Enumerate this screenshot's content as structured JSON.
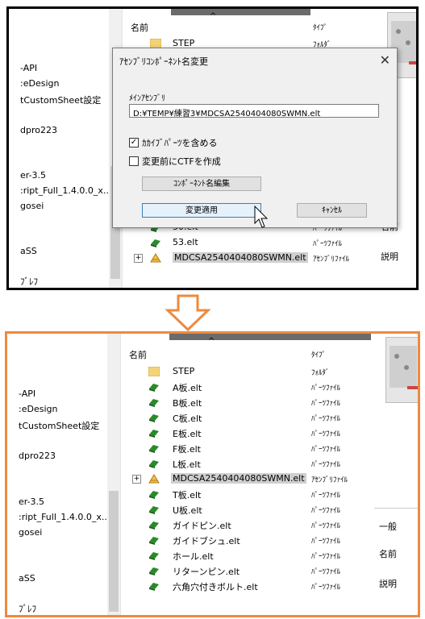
{
  "left_pane": {
    "top": [
      "-API",
      ":eDesign",
      "tCustomSheet設定",
      "dpro223"
    ],
    "bottom": [
      "er-3.5",
      ":ript_Full_1.4.0.0_x...",
      "gosei",
      "aSS",
      "ﾌﾞﾚﾌ"
    ]
  },
  "file_list": {
    "col_name": "名前",
    "col_type": "ﾀｲﾌﾟ",
    "sort_indicator": "^",
    "before_rows": [
      {
        "name": "STEP",
        "type": "ﾌｫﾙﾀﾞ",
        "icon": "folder-icon"
      },
      {
        "name": "50.elt",
        "type": "ﾊﾟｰﾂﾌｧｲﾙ",
        "icon": "part-icon"
      },
      {
        "name": "53.elt",
        "type": "ﾊﾟｰﾂﾌｧｲﾙ",
        "icon": "part-icon"
      },
      {
        "name": "MDCSA2540404080SWMN.elt",
        "type": "ｱｾﾝﾌﾞﾘﾌｧｲﾙ",
        "icon": "assembly-icon"
      }
    ],
    "after_rows": [
      {
        "name": "STEP",
        "type": "ﾌｫﾙﾀﾞ",
        "icon": "folder-icon"
      },
      {
        "name": "A板.elt",
        "type": "ﾊﾟｰﾂﾌｧｲﾙ",
        "icon": "part-icon"
      },
      {
        "name": "B板.elt",
        "type": "ﾊﾟｰﾂﾌｧｲﾙ",
        "icon": "part-icon"
      },
      {
        "name": "C板.elt",
        "type": "ﾊﾟｰﾂﾌｧｲﾙ",
        "icon": "part-icon"
      },
      {
        "name": "E板.elt",
        "type": "ﾊﾟｰﾂﾌｧｲﾙ",
        "icon": "part-icon"
      },
      {
        "name": "F板.elt",
        "type": "ﾊﾟｰﾂﾌｧｲﾙ",
        "icon": "part-icon"
      },
      {
        "name": "L板.elt",
        "type": "ﾊﾟｰﾂﾌｧｲﾙ",
        "icon": "part-icon"
      },
      {
        "name": "MDCSA2540404080SWMN.elt",
        "type": "ｱｾﾝﾌﾞﾘﾌｧｲﾙ",
        "icon": "assembly-icon"
      },
      {
        "name": "T板.elt",
        "type": "ﾊﾟｰﾂﾌｧｲﾙ",
        "icon": "part-icon"
      },
      {
        "name": "U板.elt",
        "type": "ﾊﾟｰﾂﾌｧｲﾙ",
        "icon": "part-icon"
      },
      {
        "name": "ガイドピン.elt",
        "type": "ﾊﾟｰﾂﾌｧｲﾙ",
        "icon": "part-icon"
      },
      {
        "name": "ガイドブシュ.elt",
        "type": "ﾊﾟｰﾂﾌｧｲﾙ",
        "icon": "part-icon"
      },
      {
        "name": "ホール.elt",
        "type": "ﾊﾟｰﾂﾌｧｲﾙ",
        "icon": "part-icon"
      },
      {
        "name": "リターンピン.elt",
        "type": "ﾊﾟｰﾂﾌｧｲﾙ",
        "icon": "part-icon"
      },
      {
        "name": "六角穴付きボルト.elt",
        "type": "ﾊﾟｰﾂﾌｧｲﾙ",
        "icon": "part-icon"
      }
    ]
  },
  "right_pane": {
    "before": [
      "名前",
      "説明"
    ],
    "after": [
      "一般",
      "名前",
      "説明"
    ]
  },
  "dialog": {
    "title": "ｱｾﾝﾌﾞﾘｺﾝﾎﾟｰﾈﾝﾄ名変更",
    "close": "✕",
    "main_assembly_label": "ﾒｲﾝｱｾﾝﾌﾞﾘ",
    "main_assembly_path": "D:¥TEMP¥練習3¥MDCSA2540404080SWMN.elt",
    "include_external_parts_label": "ｶｶｲﾌﾞﾊﾟｰﾂを含める",
    "include_external_parts_checked": true,
    "create_ctf_label": "変更前にCTFを作成",
    "create_ctf_checked": false,
    "component_edit_button": "ｺﾝﾎﾟｰﾈﾝﾄ名編集",
    "apply_button": "変更適用",
    "cancel_button": "ｷｬﾝｾﾙ"
  },
  "colors": {
    "before_border": "#000000",
    "after_border": "#ed8a3f",
    "arrow": "#ed8a3f",
    "part_icon": "#2a8a2a",
    "folder_icon": "#f3d37a"
  }
}
